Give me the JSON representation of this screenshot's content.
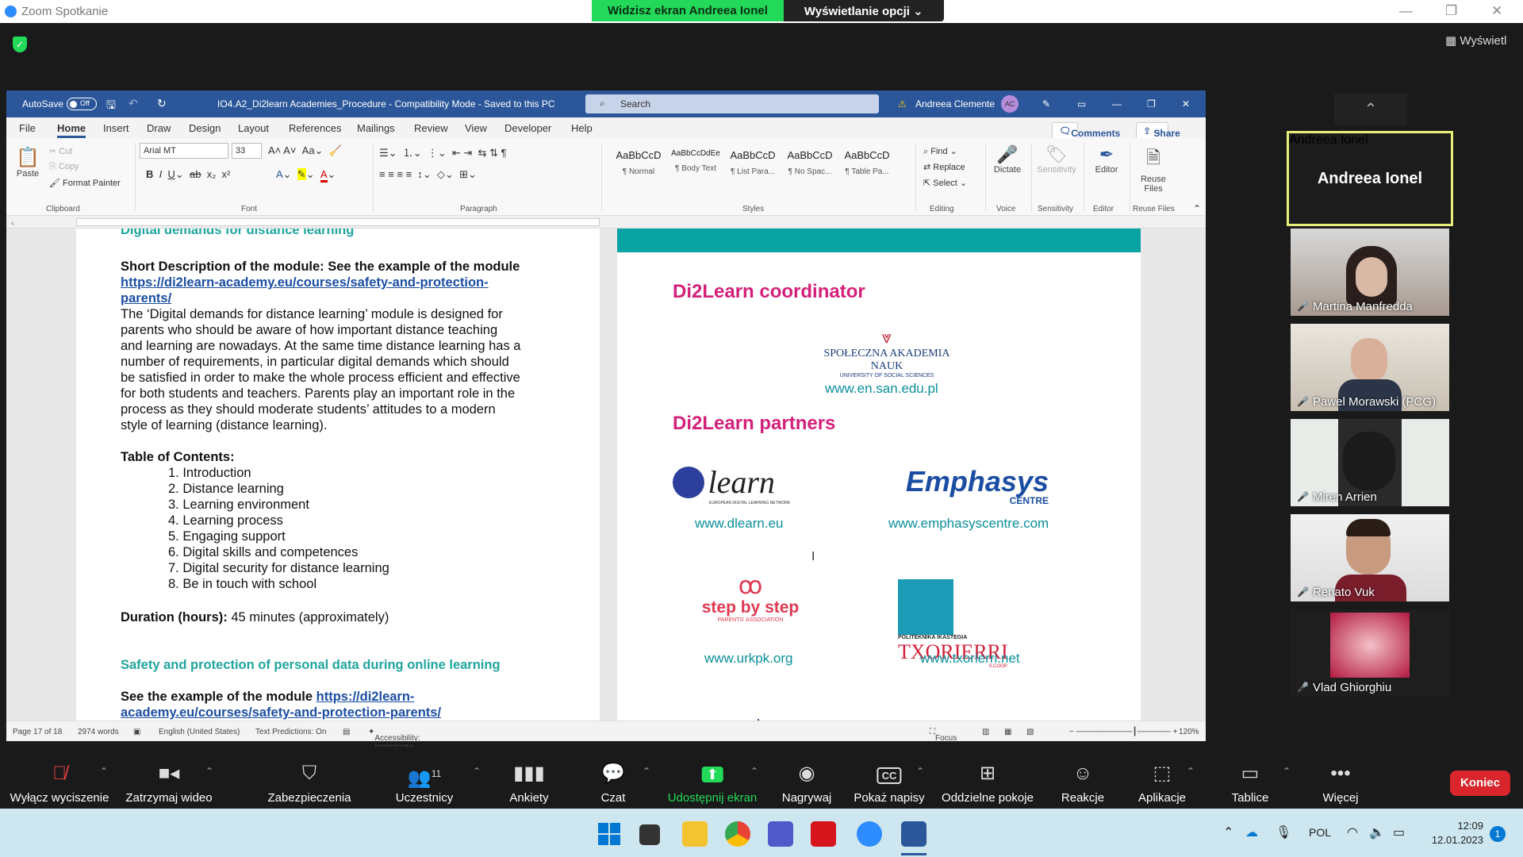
{
  "zoom": {
    "title": "Zoom Spotkanie",
    "share_banner": "Widzisz ekran Andreea Ionel",
    "view_options": "Wyświetlanie opcji",
    "view_button": "Wyświetl"
  },
  "word": {
    "autosave": "AutoSave",
    "autosave_state": "Off",
    "doc_title": "IO4.A2_Di2learn Academies_Procedure - Compatibility Mode - Saved to this PC",
    "search_placeholder": "Search",
    "user": "Andreea Clemente",
    "user_initials": "AC",
    "menu": [
      "File",
      "Home",
      "Insert",
      "Draw",
      "Design",
      "Layout",
      "References",
      "Mailings",
      "Review",
      "View",
      "Developer",
      "Help"
    ],
    "comments": "Comments",
    "share": "Share",
    "ribbon": {
      "paste": "Paste",
      "cut": "Cut",
      "copy": "Copy",
      "format_painter": "Format Painter",
      "clipboard": "Clipboard",
      "font_name": "Arial MT",
      "font_size": "33",
      "font": "Font",
      "paragraph": "Paragraph",
      "styles": [
        {
          "preview": "AaBbCcD",
          "name": "¶ Normal"
        },
        {
          "preview": "AaBbCcDdEe",
          "name": "¶ Body Text"
        },
        {
          "preview": "AaBbCcD",
          "name": "¶ List Para..."
        },
        {
          "preview": "AaBbCcD",
          "name": "¶ No Spac..."
        },
        {
          "preview": "AaBbCcD",
          "name": "¶ Table Pa..."
        }
      ],
      "styles_label": "Styles",
      "find": "Find",
      "replace": "Replace",
      "select": "Select",
      "editing": "Editing",
      "dictate": "Dictate",
      "voice": "Voice",
      "sensitivity": "Sensitivity",
      "sensitivity_group": "Sensitivity",
      "editor": "Editor",
      "editor_group": "Editor",
      "reuse": "Reuse Files",
      "reuse_group": "Reuse Files"
    },
    "left_page": {
      "heading_cut": "Digital demands for distance learning",
      "short_desc": "Short Description of the module: See the example of the module",
      "link1a": "https://di2learn-academy.eu/courses/safety-and-protection-",
      "link1b": "parents/",
      "para": [
        "The ‘Digital demands for distance learning’ module is designed for",
        "parents who should be aware of how important distance teaching",
        "and learning are nowadays. At the same time distance learning has a",
        "number of requirements, in particular digital demands which should",
        "be satisfied in order to make the whole process efficient and effective",
        "for both students and teachers. Parents play an important role in the",
        "process as they should moderate students’ attitudes to a modern",
        "style of learning (distance learning)."
      ],
      "toc_title": "Table of Contents:",
      "toc": [
        "1.  Introduction",
        "2.  Distance learning",
        "3.  Learning environment",
        "4.  Learning process",
        "5.  Engaging support",
        "6.  Digital skills and competences",
        "7.  Digital security for distance learning",
        "8.  Be in touch with school"
      ],
      "duration_label": "Duration (hours):",
      "duration_value": " 45 minutes (approximately)",
      "section2": "Safety and protection of personal data during online learning",
      "see_example": "See the example of the module ",
      "link2a": "https://di2learn-",
      "link2b": "academy.eu/courses/safety-and-protection-parents/"
    },
    "right_page": {
      "coordinator": "Di2Learn coordinator",
      "san_logo1": "SPOŁECZNA AKADEMIA NAUK",
      "san_logo2": "UNIVERSITY OF SOCIAL SCIENCES",
      "san_url": "www.en.san.edu.pl",
      "partners": "Di2Learn partners",
      "dlearn_logo": "learn",
      "dlearn_sub": "EUROPEAN DIGITAL LEARNING NETWORK",
      "dlearn_url": "www.dlearn.eu",
      "emphasys_logo": "Emphasys",
      "emphasys_sub": "CENTRE",
      "emphasys_url": "www.emphasyscentre.com",
      "step_logo": "step by step",
      "step_sub": "PARENTS' ASSOCIATION",
      "step_url": "www.urkpk.org",
      "tx_logo": "TXORIERRI",
      "tx_top": "POLITEKNIKA IKASTEGIA",
      "tx_sub": "S.COOP.",
      "tx_url": "www.txorierri.net"
    },
    "status": {
      "page": "Page 17 of 18",
      "words": "2974 words",
      "lang": "English (United States)",
      "predictions": "Text Predictions: On",
      "accessibility": "Accessibility: Investigate",
      "focus": "Focus",
      "zoom": "120%"
    }
  },
  "participants": [
    {
      "name": "Andreea Ionel",
      "active": true
    },
    {
      "name": "Martina Manfredda"
    },
    {
      "name": "Pawel Morawski (PCG)"
    },
    {
      "name": "Miren Arrien"
    },
    {
      "name": "Renato Vuk"
    },
    {
      "name": "Vlad Ghiorghiu"
    }
  ],
  "toolbar": {
    "mute": "Wyłącz wyciszenie",
    "video": "Zatrzymaj wideo",
    "security": "Zabezpieczenia",
    "participants": "Uczestnicy",
    "participants_count": "11",
    "polls": "Ankiety",
    "chat": "Czat",
    "share": "Udostępnij ekran",
    "record": "Nagrywaj",
    "captions": "Pokaż napisy",
    "captions_icon": "CC",
    "breakout": "Oddzielne pokoje",
    "reactions": "Reakcje",
    "apps": "Aplikacje",
    "whiteboards": "Tablice",
    "more": "Więcej",
    "end": "Koniec"
  },
  "taskbar": {
    "lang": "POL",
    "time": "12:09",
    "date": "12.01.2023",
    "notif": "1"
  },
  "colors": {
    "zoom_green": "#23d959",
    "word_blue": "#2b579a",
    "teal": "#0aa3a3",
    "pink": "#d4207a",
    "end_red": "#d9262c"
  }
}
